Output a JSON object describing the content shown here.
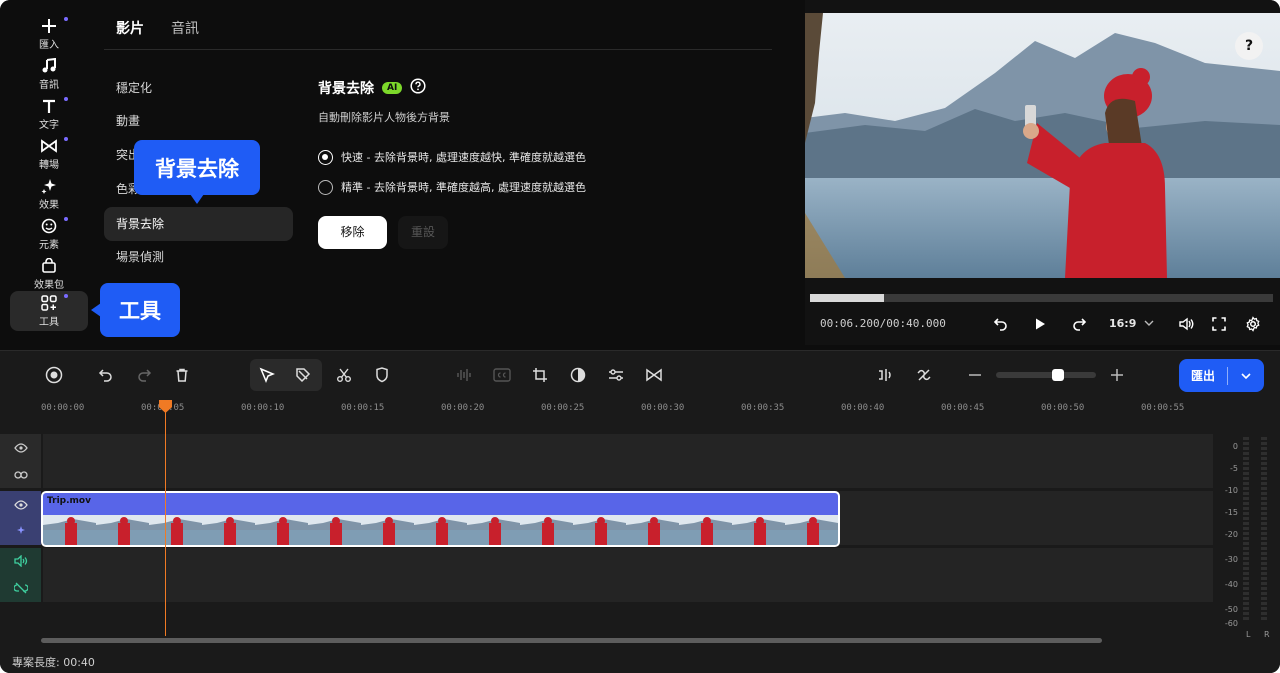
{
  "rail": {
    "items": [
      {
        "label": "匯入",
        "icon": "plus-icon",
        "dot": true
      },
      {
        "label": "音訊",
        "icon": "music-note-icon",
        "dot": false
      },
      {
        "label": "文字",
        "icon": "text-icon",
        "dot": true
      },
      {
        "label": "轉場",
        "icon": "transition-icon",
        "dot": true
      },
      {
        "label": "效果",
        "icon": "sparkle-icon",
        "dot": false
      },
      {
        "label": "元素",
        "icon": "smiley-icon",
        "dot": true
      },
      {
        "label": "效果包",
        "icon": "bag-icon",
        "dot": false
      },
      {
        "label": "工具",
        "icon": "tools-grid-icon",
        "dot": true
      }
    ]
  },
  "panel": {
    "tabs": [
      "影片",
      "音訊"
    ],
    "submenu": [
      "穩定化",
      "動畫",
      "突出",
      "色彩",
      "背景去除",
      "場景偵測"
    ],
    "active_submenu": "背景去除",
    "section_title": "背景去除",
    "ai_badge": "AI",
    "section_desc": "自動刪除影片人物後方背景",
    "options": [
      "快速 - 去除背景時, 處理速度越快, 準確度就越選色",
      "精準 - 去除背景時, 準確度越高, 處理速度就越選色"
    ],
    "remove_button": "移除",
    "reset_button": "重設"
  },
  "callouts": {
    "bg_removal": "背景去除",
    "tools": "工具"
  },
  "preview": {
    "help": "?",
    "timecode": "00:06.200/00:40.000",
    "progress": 0.16,
    "aspect_ratio": "16:9"
  },
  "timeline": {
    "export_label": "匯出",
    "ruler_labels": [
      "00:00:00",
      "00:00:05",
      "00:00:10",
      "00:00:15",
      "00:00:20",
      "00:00:25",
      "00:00:30",
      "00:00:35",
      "00:00:40",
      "00:00:45",
      "00:00:50",
      "00:00:55"
    ],
    "clip_name": "Trip.mov",
    "project_length": "專案長度: 00:40",
    "meter_labels": [
      "0",
      "-5",
      "-10",
      "-15",
      "-20",
      "-30",
      "-40",
      "-50",
      "-60"
    ],
    "meter_lr": [
      "L",
      "R"
    ]
  },
  "colors": {
    "accent": "#1f5cf5",
    "clip": "#5865e8",
    "playhead": "#f07a24",
    "ai_badge": "#7cd82a"
  }
}
